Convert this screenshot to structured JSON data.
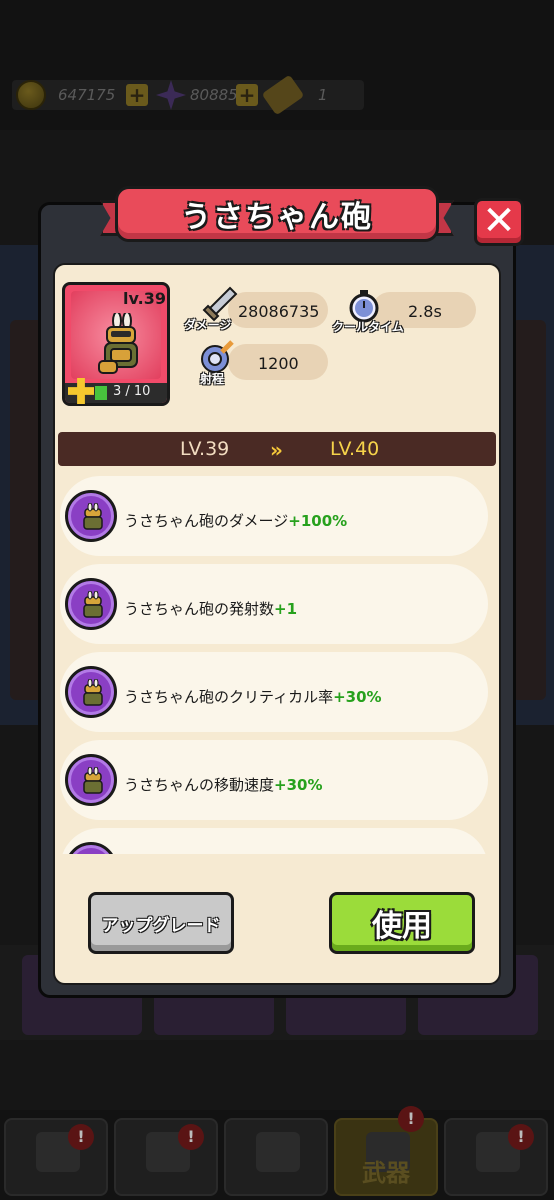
{
  "currency": {
    "coins": "647175",
    "gems": "80885",
    "tickets": "1"
  },
  "modal": {
    "title": "うさちゃん砲",
    "close_icon": "close-icon"
  },
  "weapon": {
    "level_label": "lv.39",
    "fragments": "3 / 10",
    "fragments_progress": 0.3,
    "stats": {
      "damage_label": "ダメージ",
      "damage_value": "28086735",
      "cooldown_label": "クールタイム",
      "cooldown_value": "2.8s",
      "range_label": "射程",
      "range_value": "1200"
    }
  },
  "level": {
    "from": "LV.39",
    "arrow": "»",
    "to": "LV.40"
  },
  "upgrades": [
    {
      "text": "うさちゃん砲のダメージ",
      "bonus": "+100%"
    },
    {
      "text": "うさちゃん砲の発射数",
      "bonus": "+1"
    },
    {
      "text": "うさちゃん砲のクリティカル率",
      "bonus": "+30%"
    },
    {
      "text": "うさちゃんの移動速度",
      "bonus": "+30%"
    }
  ],
  "buttons": {
    "upgrade": "アップグレード",
    "use": "使用"
  },
  "nav": {
    "weapon_label": "武器",
    "badge": "!"
  },
  "colors": {
    "ribbon": "#e94b5a",
    "use_button": "#9bdc3a",
    "bonus_text": "#27a11d",
    "panel": "#f6ead2"
  }
}
